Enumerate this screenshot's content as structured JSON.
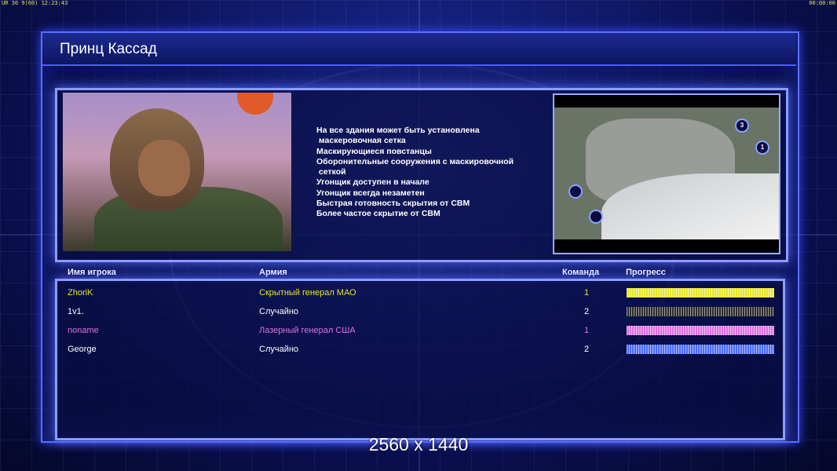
{
  "hud": {
    "top_left": "UR 30 9(60) 12:23:43",
    "top_right": "00:00:00"
  },
  "general": {
    "name": "Принц Кассад",
    "description": [
      "На все здания может быть установлена",
      " маскеровочная сетка",
      "Маскирующиеся повстанцы",
      "Оборонительные сооружения с маскировочной",
      " сеткой",
      "Угонщик доступен в начале",
      "Угонщик всегда незаметен",
      "Быстрая готовность скрытия от СВМ",
      "Более частое скрытие от СВМ"
    ]
  },
  "map": {
    "spawns": [
      "3",
      "1",
      "",
      ""
    ]
  },
  "table": {
    "headers": {
      "player": "Имя игрока",
      "army": "Армия",
      "team": "Команда",
      "progress": "Прогресс"
    },
    "rows": [
      {
        "player": "ZhoriK",
        "army": "Скрытный генерал МАО",
        "team": "1",
        "color": "#e6e62a",
        "progress": 1.0
      },
      {
        "player": "1v1.",
        "army": "Случайно",
        "team": "2",
        "color": "#ffffff",
        "bar_color": "#2a2a2a",
        "progress": 1.0
      },
      {
        "player": "noname",
        "army": "Лазерный генерал США",
        "team": "1",
        "color": "#e070e0",
        "progress": 1.0
      },
      {
        "player": "George",
        "army": "Случайно",
        "team": "2",
        "color": "#ffffff",
        "bar_color": "#4a6aff",
        "progress": 1.0
      }
    ]
  },
  "footer": {
    "resolution": "2560 x 1440"
  }
}
